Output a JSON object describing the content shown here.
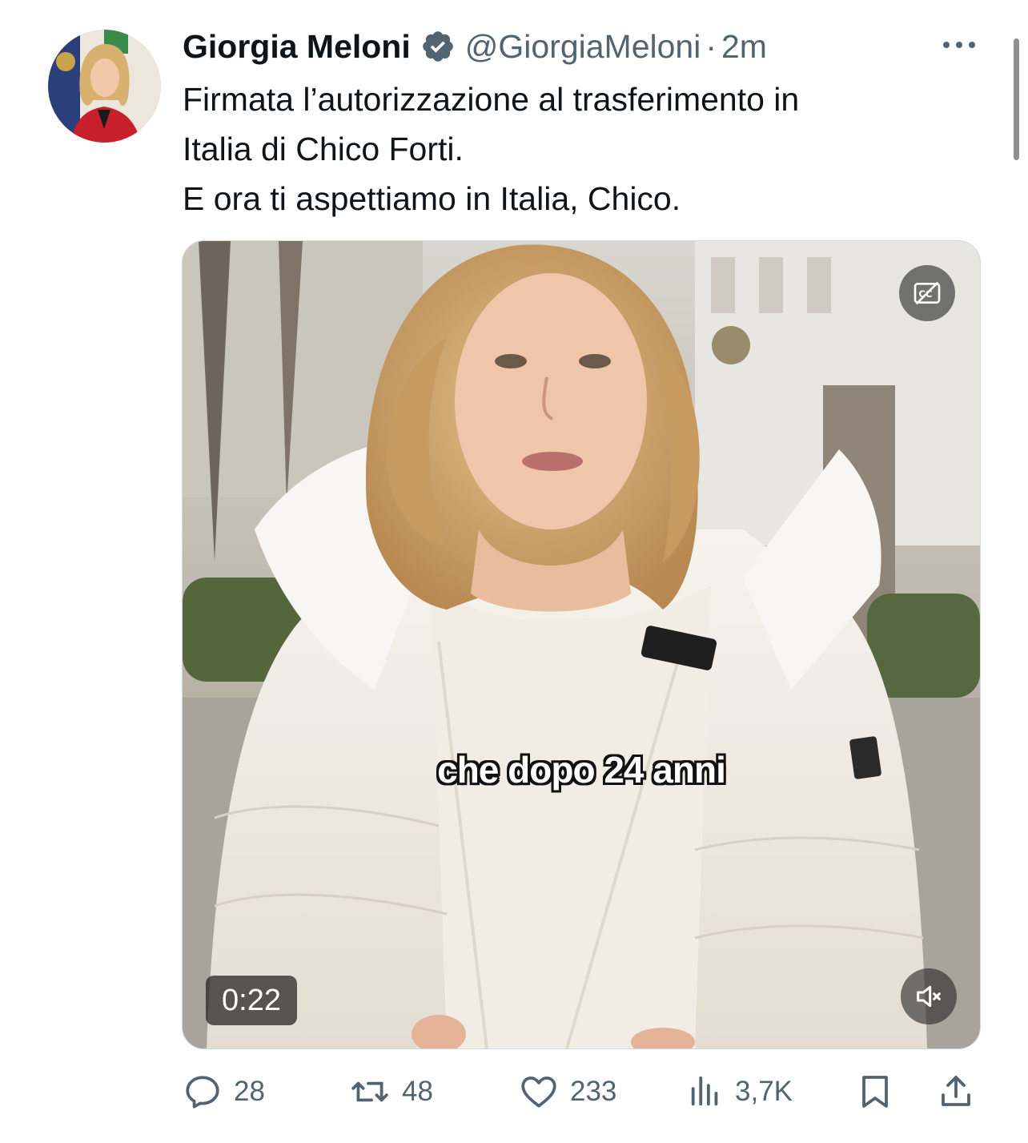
{
  "author": {
    "name": "Giorgia Meloni",
    "handle": "@GiorgiaMeloni",
    "separator": "·",
    "time": "2m",
    "verified": true
  },
  "tweet": {
    "lines": [
      "Firmata l’autorizzazione al trasferimento in",
      "Italia di Chico Forti.",
      "E ora ti aspettiamo in Italia, Chico."
    ]
  },
  "video": {
    "duration": "0:22",
    "caption": "che dopo 24 anni",
    "muted": true
  },
  "metrics": {
    "replies": "28",
    "reposts": "48",
    "likes": "233",
    "views": "3,7K"
  },
  "icons": {
    "verified": "verified-badge-icon",
    "more": "more-options-icon",
    "captions": "closed-captions-icon",
    "mute": "muted-speaker-icon",
    "reply": "reply-icon",
    "repost": "repost-icon",
    "like": "heart-icon",
    "views": "views-icon",
    "bookmark": "bookmark-icon",
    "share": "share-icon"
  },
  "colors": {
    "text": "#0f1419",
    "secondary": "#536471",
    "verified": "#536471"
  }
}
